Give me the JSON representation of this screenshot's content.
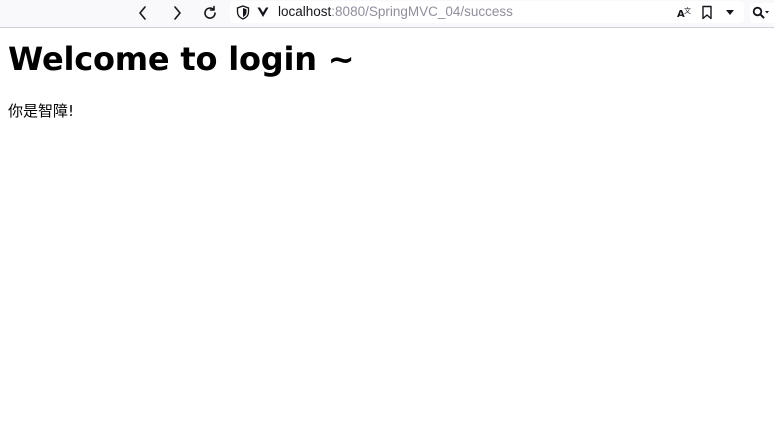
{
  "browser": {
    "url_host": "localhost",
    "url_path": ":8080/SpringMVC_04/success",
    "icons": {
      "back": "chevron-left-icon",
      "forward": "chevron-right-icon",
      "reload": "reload-icon",
      "shield": "shield-icon",
      "site": "site-v-icon",
      "translate": "translate-icon",
      "bookmark": "bookmark-icon",
      "dropdown": "dropdown-icon",
      "search": "search-icon"
    }
  },
  "page": {
    "heading": "Welcome to login ~",
    "message": "你是智障!"
  }
}
